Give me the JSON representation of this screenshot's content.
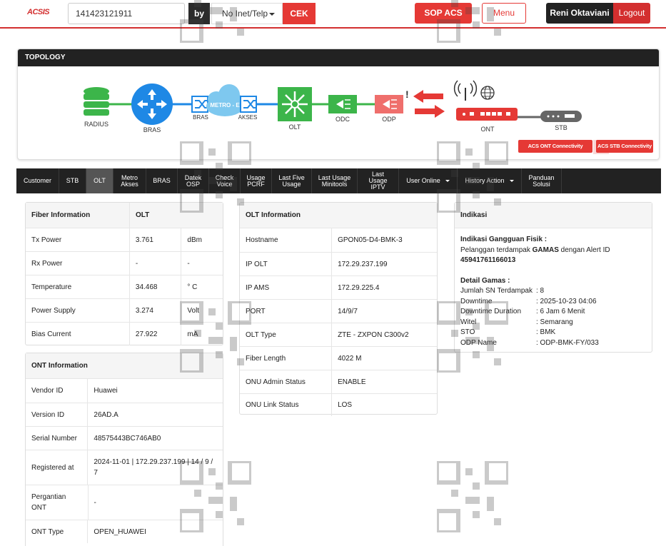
{
  "header": {
    "logo_text": "ACSIS",
    "search_value": "141423121911",
    "by_label": "by",
    "search_type": "No Inet/Telp",
    "cek_label": "CEK",
    "sop_label": "SOP ACS",
    "menu_label": "Menu",
    "user_name": "Reni Oktaviani",
    "logout_label": "Logout"
  },
  "topology": {
    "title": "TOPOLOGY",
    "nodes": {
      "radius": "RADIUS",
      "bras": "BRAS",
      "metro_bras": "BRAS",
      "metro_label": "METRO - E",
      "metro_akses": "AKSES",
      "olt": "OLT",
      "odc": "ODC",
      "odp": "ODP",
      "ont": "ONT",
      "stb": "STB"
    },
    "colors": {
      "green": "#3cb54a",
      "blue": "#1e88e5",
      "red": "#e53935",
      "grey": "#666666"
    },
    "acs_ont_label": "ACS ONT Connectivity",
    "acs_stb_label": "ACS STB Connectivity"
  },
  "tabs": [
    {
      "label": "Customer"
    },
    {
      "label": "STB"
    },
    {
      "label": "OLT",
      "active": true
    },
    {
      "label": "Metro Akses"
    },
    {
      "label": "BRAS"
    },
    {
      "label": "Datek OSP"
    },
    {
      "label": "Check Voice"
    },
    {
      "label": "Usage PCRF"
    },
    {
      "label": "Last Five Usage"
    },
    {
      "label": "Last Usage Minitools"
    },
    {
      "label": "Last Usage IPTV"
    },
    {
      "label": "User Online",
      "dropdown": true
    },
    {
      "label": "History Action",
      "dropdown": true
    },
    {
      "label": "Panduan Solusi"
    }
  ],
  "fiber": {
    "header": [
      "Fiber Information",
      "OLT",
      ""
    ],
    "rows": [
      [
        "Tx Power",
        "3.761",
        "dBm"
      ],
      [
        "Rx Power",
        "-",
        "-"
      ],
      [
        "Temperature",
        "34.468",
        "° C"
      ],
      [
        "Power Supply",
        "3.274",
        "Volt"
      ],
      [
        "Bias Current",
        "27.922",
        "mA"
      ]
    ]
  },
  "ont": {
    "title": "ONT Information",
    "rows": [
      [
        "Vendor ID",
        "Huawei"
      ],
      [
        "Version ID",
        "26AD.A"
      ],
      [
        "Serial Number",
        "48575443BC746AB0"
      ],
      [
        "Registered at",
        "2024-11-01 | 172.29.237.199 | 14 / 9 / 7"
      ],
      [
        "Pergantian ONT",
        "-"
      ],
      [
        "ONT Type",
        "OPEN_HUAWEI"
      ]
    ]
  },
  "olt": {
    "title": "OLT Information",
    "rows": [
      [
        "Hostname",
        "GPON05-D4-BMK-3"
      ],
      [
        "IP OLT",
        "172.29.237.199"
      ],
      [
        "IP AMS",
        "172.29.225.4"
      ],
      [
        "PORT",
        "14/9/7"
      ],
      [
        "OLT Type",
        "ZTE - ZXPON C300v2"
      ],
      [
        "Fiber Length",
        "4022 M"
      ],
      [
        "ONU Admin Status",
        "ENABLE"
      ],
      [
        "ONU Link Status",
        "LOS"
      ]
    ]
  },
  "indikasi": {
    "title": "Indikasi",
    "gangguan_label": "Indikasi Gangguan Fisik :",
    "line_prefix": "Pelanggan terdampak",
    "line_bold": "GAMAS",
    "line_suffix": "dengan Alert ID",
    "alert_id": "45941761166013",
    "detail_label": "Detail Gamas :",
    "details": [
      [
        "Jumlah SN Terdampak",
        ": 8"
      ],
      [
        "Downtime",
        ": 2025-10-23 04:06"
      ],
      [
        "Downtime Duration",
        ": 6 Jam 6 Menit"
      ],
      [
        "Witel",
        ": Semarang"
      ],
      [
        "STO",
        ": BMK"
      ],
      [
        "ODP Name",
        ": ODP-BMK-FY/033"
      ]
    ]
  }
}
